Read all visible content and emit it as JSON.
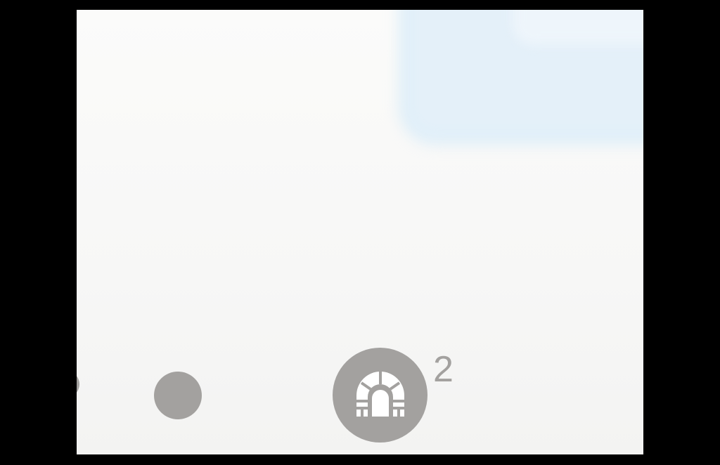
{
  "page_indicator": {
    "items": [
      {
        "type": "dot"
      },
      {
        "type": "dot"
      },
      {
        "type": "dot",
        "icon": "tunnel-arch-icon",
        "badge": "2"
      }
    ]
  },
  "colors": {
    "indicator_gray": "#a3a19f",
    "background": "#f7f7f6",
    "bezel": "#000000",
    "blurred_card": "#d6ebf8"
  }
}
